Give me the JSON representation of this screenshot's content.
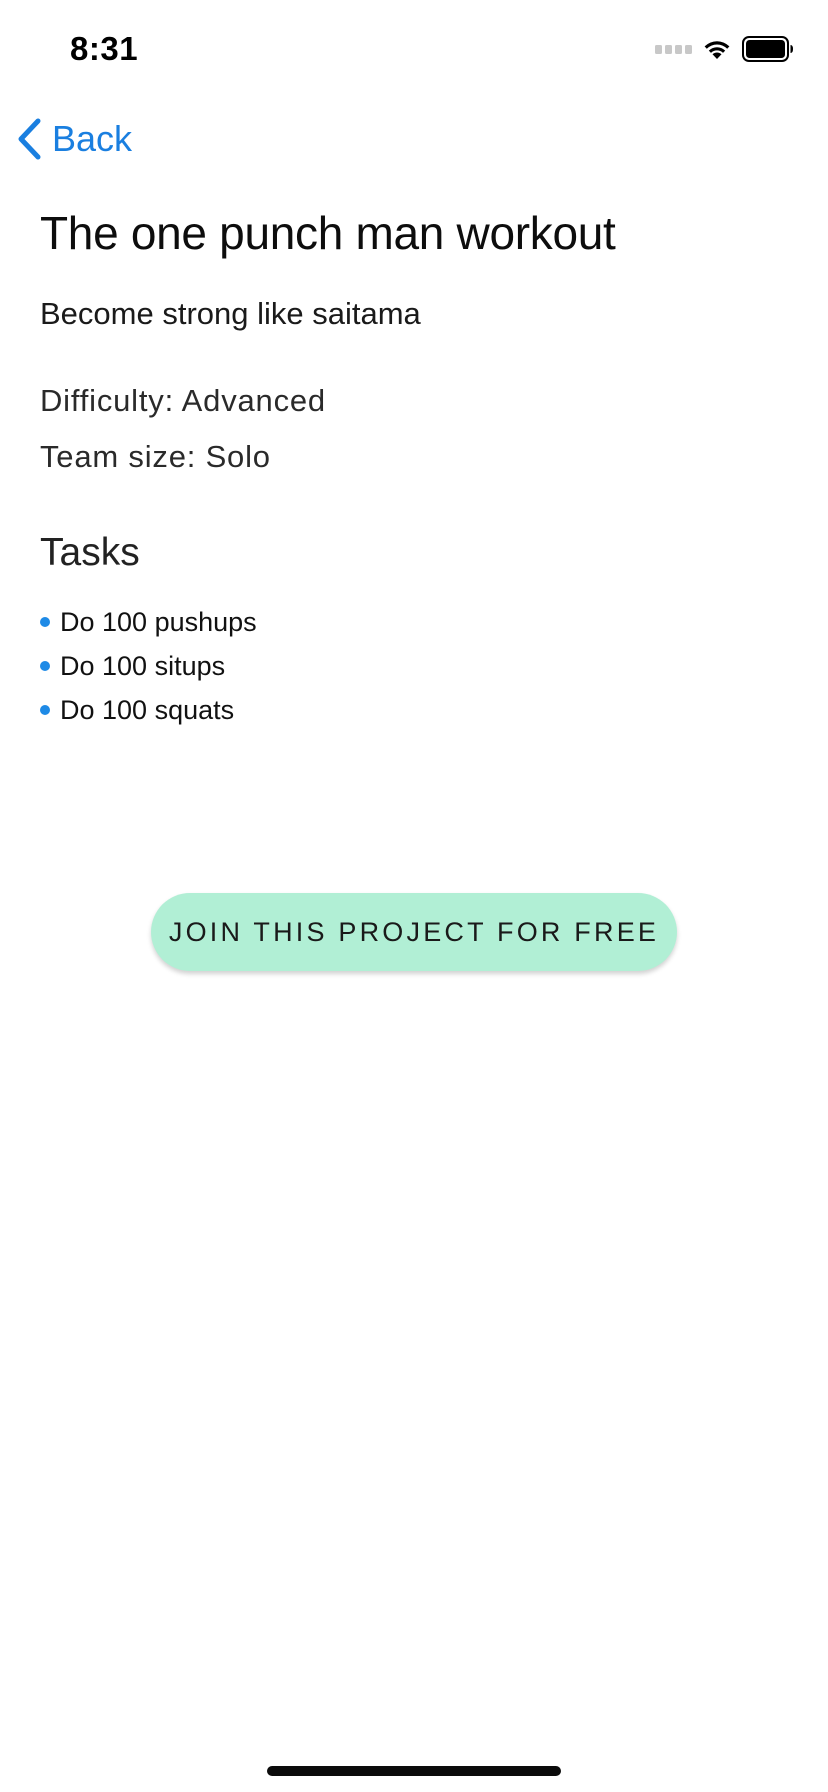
{
  "status_bar": {
    "time": "8:31",
    "icons": [
      "signal-icon",
      "wifi-icon",
      "battery-icon"
    ]
  },
  "nav": {
    "back_label": "Back",
    "back_icon": "chevron-left-icon"
  },
  "project": {
    "title": "The one punch man workout",
    "subtitle": "Become strong like saitama",
    "difficulty": "Difficulty: Advanced",
    "team_size": "Team size: Solo"
  },
  "tasks": {
    "heading": "Tasks",
    "items": [
      {
        "label": "Do 100 pushups"
      },
      {
        "label": "Do 100 situps"
      },
      {
        "label": "Do 100 squats"
      }
    ]
  },
  "actions": {
    "join_label": "JOIN THIS PROJECT FOR FREE"
  },
  "colors": {
    "accent": "#1a7fe0",
    "bullet": "#1e8ae6",
    "join_button": "#b1efd5"
  }
}
